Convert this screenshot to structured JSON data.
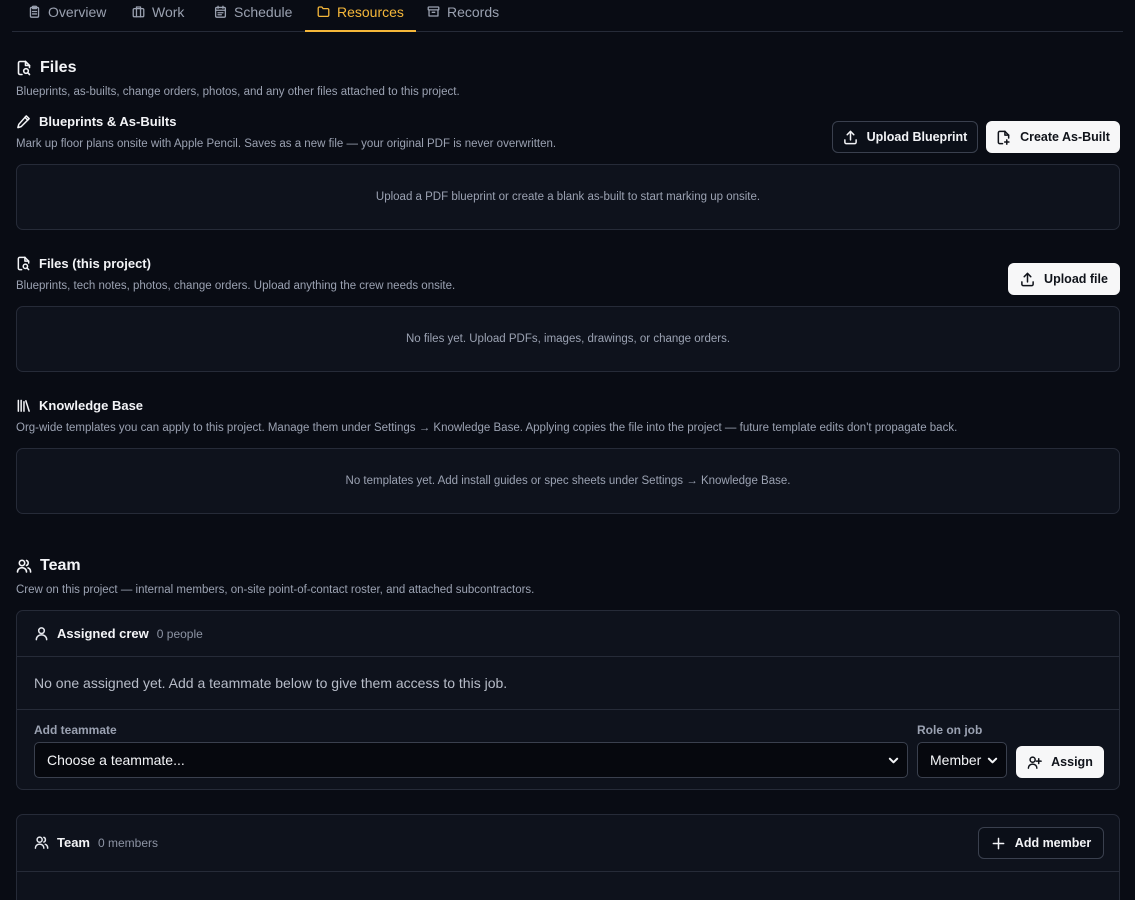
{
  "tabs": [
    {
      "label": "Overview",
      "icon": "clipboard-icon"
    },
    {
      "label": "Work",
      "icon": "briefcase-icon"
    },
    {
      "label": "Schedule",
      "icon": "calendar-icon"
    },
    {
      "label": "Resources",
      "icon": "folder-icon",
      "active": true
    },
    {
      "label": "Records",
      "icon": "archive-icon"
    }
  ],
  "accent_color": "#f5b73a",
  "files": {
    "title": "Files",
    "description": "Blueprints, as-builts, change orders, photos, and any other files attached to this project."
  },
  "blueprints": {
    "title": "Blueprints & As-Builts",
    "description": "Mark up floor plans onsite with Apple Pencil. Saves as a new file — your original PDF is never overwritten.",
    "upload_button": "Upload Blueprint",
    "create_button": "Create As-Built",
    "empty": "Upload a PDF blueprint or create a blank as-built to start marking up onsite."
  },
  "project_files": {
    "title": "Files (this project)",
    "description": "Blueprints, tech notes, photos, change orders. Upload anything the crew needs onsite.",
    "upload_button": "Upload file",
    "empty": "No files yet. Upload PDFs, images, drawings, or change orders."
  },
  "knowledge_base": {
    "title": "Knowledge Base",
    "description": "Org-wide templates you can apply to this project. Manage them under Settings → Knowledge Base. Applying copies the file into the project — future template edits don't propagate back.",
    "empty": "No templates yet. Add install guides or spec sheets under Settings → Knowledge Base."
  },
  "team": {
    "title": "Team",
    "description": "Crew on this project — internal members, on-site point-of-contact roster, and attached subcontractors."
  },
  "assigned_crew": {
    "title": "Assigned crew",
    "count": "0 people",
    "empty": "No one assigned yet. Add a teammate below to give them access to this job.",
    "add_label": "Add teammate",
    "teammate_select": "Choose a teammate...",
    "role_label": "Role on job",
    "role_select": "Member",
    "assign_button": "Assign"
  },
  "team_panel": {
    "title": "Team",
    "count": "0 members",
    "add_button": "Add member"
  }
}
